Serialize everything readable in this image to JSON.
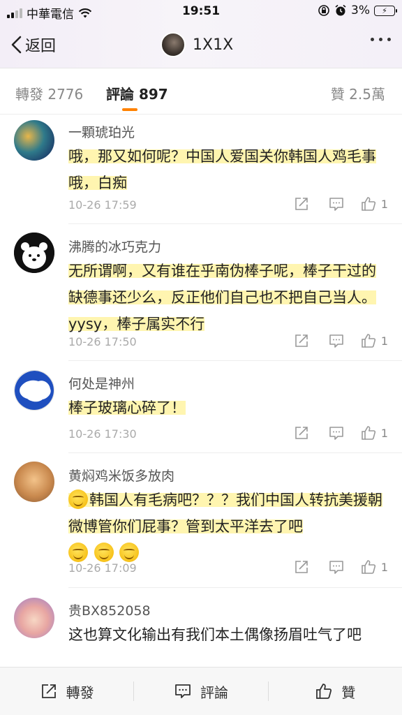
{
  "status_bar": {
    "carrier": "中華電信",
    "time": "19:51",
    "battery": "3%"
  },
  "nav": {
    "back_label": "返回",
    "title": "1X1X"
  },
  "tabs": {
    "repost": "轉發 2776",
    "comments": "評論 897",
    "likes": "贊 2.5萬"
  },
  "comments": [
    {
      "name": "一顆琥珀光",
      "text": "哦，那又如何呢？中国人爱国关你韩国人鸡毛事哦，白痴",
      "time": "10-26 17:59",
      "likes": "1"
    },
    {
      "name": "沸腾的冰巧克力",
      "text": "无所谓啊，又有谁在乎南伪棒子呢，棒子干过的缺德事还少么，反正他们自己也不把自己当人。yysy，棒子属实不行",
      "time": "10-26 17:50",
      "likes": "1"
    },
    {
      "name": "何处是神州",
      "text": "棒子玻璃心碎了！",
      "time": "10-26 17:30",
      "likes": "1"
    },
    {
      "name": "黄焖鸡米饭多放肉",
      "text": "韩国人有毛病吧？？？我们中国人转抗美援朝微博管你们屁事？管到太平洋去了吧",
      "time": "10-26 17:09",
      "likes": "1"
    },
    {
      "name": "贵BX852058",
      "text": "这也算文化输出有我们本土偶像扬眉吐气了吧",
      "time": "",
      "likes": ""
    }
  ],
  "toolbar": {
    "repost": "轉發",
    "comment": "評論",
    "like": "贊"
  },
  "colors": {
    "accent": "#ff8200",
    "highlight": "#fff296"
  }
}
